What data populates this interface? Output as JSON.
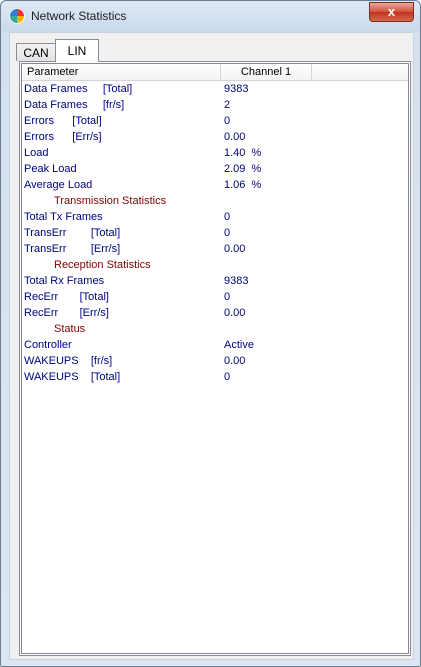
{
  "window": {
    "title": "Network Statistics",
    "close_label": "x"
  },
  "tabs": [
    {
      "label": "CAN",
      "selected": false
    },
    {
      "label": "LIN",
      "selected": true
    }
  ],
  "table": {
    "columns": [
      "Parameter",
      "Channel 1"
    ],
    "rows": [
      {
        "name": "Data Frames     [Total]",
        "value": "9383"
      },
      {
        "name": "Data Frames     [fr/s]",
        "value": "2"
      },
      {
        "name": "Errors      [Total]",
        "value": "0"
      },
      {
        "name": "Errors      [Err/s]",
        "value": "0.00"
      },
      {
        "name": "Load",
        "value": "1.40  %"
      },
      {
        "name": "Peak Load",
        "value": "2.09  %"
      },
      {
        "name": "Average Load",
        "value": "1.06  %"
      },
      {
        "name": "Transmission Statistics",
        "value": "",
        "section": true
      },
      {
        "name": "Total Tx Frames",
        "value": "0"
      },
      {
        "name": "TransErr        [Total]",
        "value": "0"
      },
      {
        "name": "TransErr        [Err/s]",
        "value": "0.00"
      },
      {
        "name": "Reception Statistics",
        "value": "",
        "section": true
      },
      {
        "name": "Total Rx Frames",
        "value": "9383"
      },
      {
        "name": "RecErr       [Total]",
        "value": "0"
      },
      {
        "name": "RecErr       [Err/s]",
        "value": "0.00"
      },
      {
        "name": "Status",
        "value": "",
        "section": true
      },
      {
        "name": "Controller",
        "value": "Active"
      },
      {
        "name": "WAKEUPS    [fr/s]",
        "value": "0.00"
      },
      {
        "name": "WAKEUPS    [Total]",
        "value": "0"
      }
    ]
  },
  "colors": {
    "value_text": "#000080",
    "section_text": "#800000"
  },
  "icons": {
    "app": "network-statistics-icon",
    "close": "close-icon"
  }
}
